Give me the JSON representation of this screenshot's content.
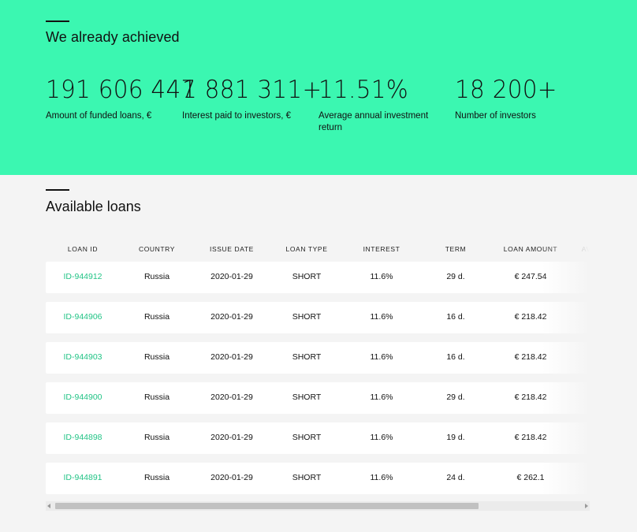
{
  "achieved": {
    "title": "We already achieved",
    "stats": [
      {
        "value": "191 606 447",
        "label": "Amount of funded loans, €"
      },
      {
        "value": "1 881 311+",
        "label": "Interest paid to investors, €"
      },
      {
        "value": "11.51%",
        "label": "Average annual investment return"
      },
      {
        "value": "18 200+",
        "label": "Number of investors"
      }
    ]
  },
  "loans": {
    "title": "Available loans",
    "columns": [
      "LOAN ID",
      "COUNTRY",
      "ISSUE DATE",
      "LOAN TYPE",
      "INTEREST",
      "TERM",
      "LOAN AMOUNT",
      "AVAI"
    ],
    "rows": [
      {
        "id": "ID-944912",
        "country": "Russia",
        "issue_date": "2020-01-29",
        "type": "SHORT",
        "interest": "11.6%",
        "term": "29 d.",
        "amount": "€ 247.54"
      },
      {
        "id": "ID-944906",
        "country": "Russia",
        "issue_date": "2020-01-29",
        "type": "SHORT",
        "interest": "11.6%",
        "term": "16 d.",
        "amount": "€ 218.42"
      },
      {
        "id": "ID-944903",
        "country": "Russia",
        "issue_date": "2020-01-29",
        "type": "SHORT",
        "interest": "11.6%",
        "term": "16 d.",
        "amount": "€ 218.42"
      },
      {
        "id": "ID-944900",
        "country": "Russia",
        "issue_date": "2020-01-29",
        "type": "SHORT",
        "interest": "11.6%",
        "term": "29 d.",
        "amount": "€ 218.42"
      },
      {
        "id": "ID-944898",
        "country": "Russia",
        "issue_date": "2020-01-29",
        "type": "SHORT",
        "interest": "11.6%",
        "term": "19 d.",
        "amount": "€ 218.42"
      },
      {
        "id": "ID-944891",
        "country": "Russia",
        "issue_date": "2020-01-29",
        "type": "SHORT",
        "interest": "11.6%",
        "term": "24 d.",
        "amount": "€ 262.1"
      }
    ]
  },
  "colors": {
    "hero_bg": "#3bf7b1",
    "loan_id": "#22c486",
    "page_bg": "#f4f4f4"
  },
  "icons": {
    "scroll_left": "scroll-left-arrow-icon",
    "scroll_right": "scroll-right-arrow-icon"
  }
}
